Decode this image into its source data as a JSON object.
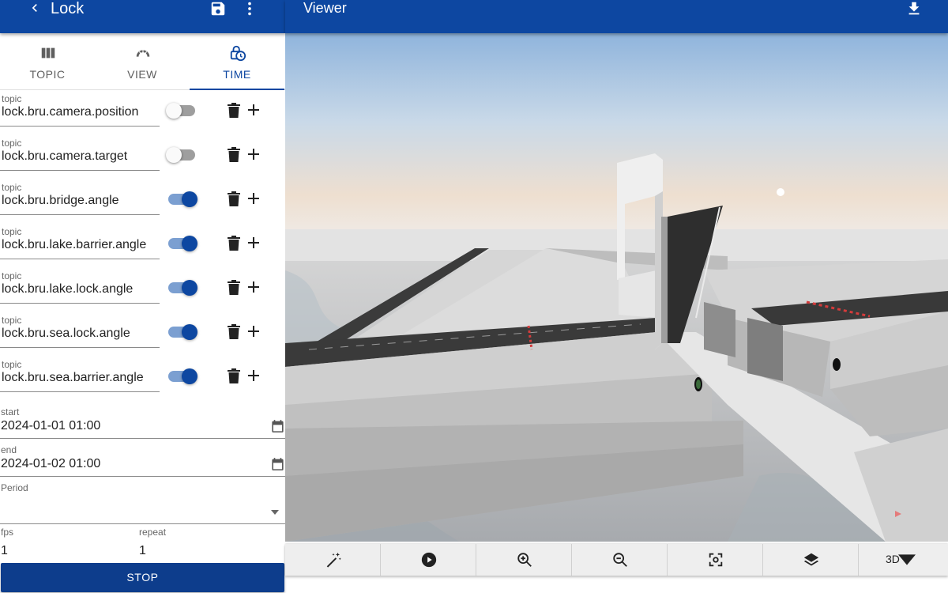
{
  "left_panel": {
    "title": "Lock",
    "icons": {
      "back": "chevron-left-icon",
      "save": "save-icon",
      "more": "more-vert-icon"
    }
  },
  "tabs": [
    {
      "label": "TOPIC",
      "icon": "columns-icon",
      "active": false
    },
    {
      "label": "VIEW",
      "icon": "view-arc-icon",
      "active": false
    },
    {
      "label": "TIME",
      "icon": "time-lock-icon",
      "active": true
    }
  ],
  "topics": [
    {
      "caption": "topic",
      "value": "lock.bru.camera.position",
      "enabled": false
    },
    {
      "caption": "topic",
      "value": "lock.bru.camera.target",
      "enabled": false
    },
    {
      "caption": "topic",
      "value": "lock.bru.bridge.angle",
      "enabled": true
    },
    {
      "caption": "topic",
      "value": "lock.bru.lake.barrier.angle",
      "enabled": true
    },
    {
      "caption": "topic",
      "value": "lock.bru.lake.lock.angle",
      "enabled": true
    },
    {
      "caption": "topic",
      "value": "lock.bru.sea.lock.angle",
      "enabled": true
    },
    {
      "caption": "topic",
      "value": "lock.bru.sea.barrier.angle",
      "enabled": true
    }
  ],
  "time": {
    "start_label": "start",
    "start_value": "2024-01-01 01:00",
    "end_label": "end",
    "end_value": "2024-01-02 01:00",
    "period_label": "Period",
    "period_value": "",
    "fps_label": "fps",
    "fps_value": "1",
    "repeat_label": "repeat",
    "repeat_value": "1"
  },
  "stop_button": "STOP",
  "viewer": {
    "title": "Viewer",
    "download_icon": "download-icon",
    "toolbar": [
      {
        "icon": "auto-fix-icon"
      },
      {
        "icon": "play-circle-icon"
      },
      {
        "icon": "zoom-in-icon"
      },
      {
        "icon": "zoom-out-icon"
      },
      {
        "icon": "center-focus-icon"
      },
      {
        "icon": "layers-icon"
      }
    ],
    "mode_select": "3D"
  },
  "colors": {
    "primary": "#0d47a1",
    "switch_on": "#0d47a1",
    "toolbar_bg": "#eeeeee"
  }
}
